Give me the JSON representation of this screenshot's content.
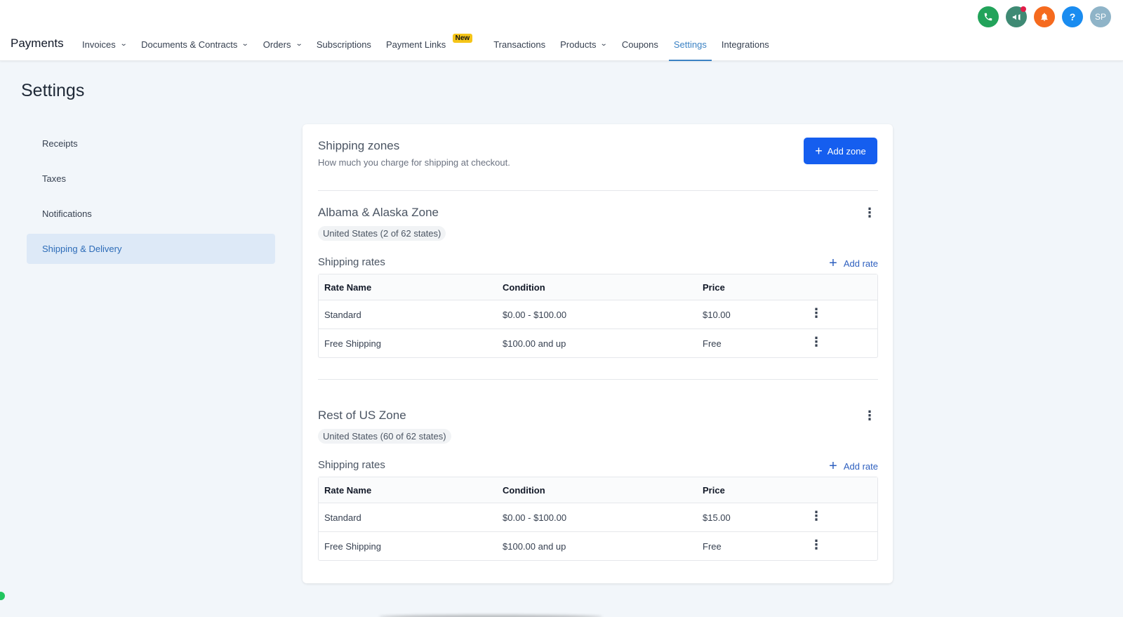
{
  "app": {
    "brand": "Payments"
  },
  "nav": {
    "items": [
      {
        "label": "Invoices",
        "dropdown": true
      },
      {
        "label": "Documents & Contracts",
        "dropdown": true
      },
      {
        "label": "Orders",
        "dropdown": true
      },
      {
        "label": "Subscriptions",
        "dropdown": false
      },
      {
        "label": "Payment Links",
        "dropdown": false,
        "badge": "New"
      },
      {
        "label": "Transactions",
        "dropdown": false
      },
      {
        "label": "Products",
        "dropdown": true
      },
      {
        "label": "Coupons",
        "dropdown": false
      },
      {
        "label": "Settings",
        "dropdown": false,
        "active": true
      },
      {
        "label": "Integrations",
        "dropdown": false
      }
    ]
  },
  "header_icons": {
    "phone": "phone-icon",
    "announce": "megaphone-icon",
    "bell": "bell-icon",
    "help": "help-icon",
    "help_glyph": "?",
    "avatar_initials": "SP"
  },
  "page": {
    "title": "Settings"
  },
  "sidebar": {
    "items": [
      {
        "label": "Receipts"
      },
      {
        "label": "Taxes"
      },
      {
        "label": "Notifications"
      },
      {
        "label": "Shipping & Delivery",
        "active": true
      }
    ]
  },
  "shipping": {
    "title": "Shipping zones",
    "subtitle": "How much you charge for shipping at checkout.",
    "add_zone_label": "Add zone",
    "zones": [
      {
        "name": "Albama & Alaska Zone",
        "region": "United States (2 of 62 states)",
        "rates_title": "Shipping rates",
        "add_rate_label": "Add rate",
        "columns": [
          "Rate Name",
          "Condition",
          "Price"
        ],
        "rows": [
          {
            "name": "Standard",
            "condition": "$0.00 - $100.00",
            "price": "$10.00"
          },
          {
            "name": "Free Shipping",
            "condition": "$100.00 and up",
            "price": "Free"
          }
        ]
      },
      {
        "name": "Rest of US Zone",
        "region": "United States (60 of 62 states)",
        "rates_title": "Shipping rates",
        "add_rate_label": "Add rate",
        "columns": [
          "Rate Name",
          "Condition",
          "Price"
        ],
        "rows": [
          {
            "name": "Standard",
            "condition": "$0.00 - $100.00",
            "price": "$15.00"
          },
          {
            "name": "Free Shipping",
            "condition": "$100.00 and up",
            "price": "Free"
          }
        ]
      }
    ]
  },
  "colors": {
    "primary": "#155eef",
    "active_nav": "#3b82c4",
    "sidebar_active_bg": "#dde9f7",
    "badge": "#f5c518"
  }
}
